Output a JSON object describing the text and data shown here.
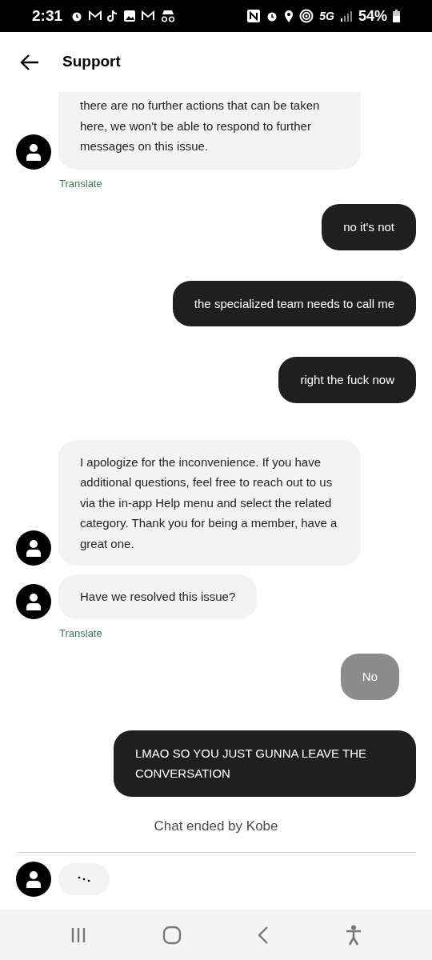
{
  "status_bar": {
    "time": "2:31",
    "network": "5G",
    "battery": "54%"
  },
  "header": {
    "title": "Support"
  },
  "messages": [
    {
      "kind": "agent",
      "text": "there are no further actions that can be taken here, we won't be able to respond to further messages on this issue.",
      "translate": "Translate",
      "continued": true
    },
    {
      "kind": "user",
      "text": "no it's not",
      "delivered": true
    },
    {
      "kind": "user",
      "text": "the specialized team needs to call me",
      "delivered": true
    },
    {
      "kind": "user",
      "text": "right the fuck now",
      "delivered": true
    },
    {
      "kind": "agent",
      "text": "I apologize for the inconvenience. If you have additional questions, feel free to reach out to us via the in-app Help menu and select the related category. Thank you for being a member, have a great one.",
      "continued": false
    },
    {
      "kind": "agent",
      "text": "Have we resolved this issue?",
      "translate": "Translate",
      "continued": false
    },
    {
      "kind": "user",
      "text": "No",
      "delivered": false
    },
    {
      "kind": "user",
      "text": "LMAO SO YOU JUST GUNNA LEAVE THE CONVERSATION",
      "delivered": true
    }
  ],
  "chat_ended": "Chat ended by Kobe"
}
